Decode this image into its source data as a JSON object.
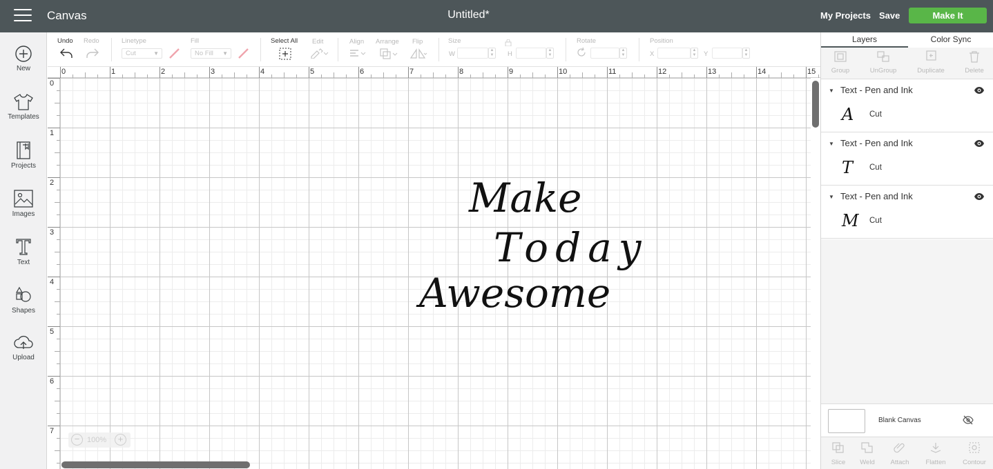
{
  "header": {
    "app_title": "Canvas",
    "doc_title": "Untitled*",
    "my_projects": "My Projects",
    "save": "Save",
    "make_it": "Make It",
    "make_it_color": "#59b648"
  },
  "sidebar": {
    "items": [
      {
        "label": "New",
        "icon": "plus-circle-icon"
      },
      {
        "label": "Templates",
        "icon": "tshirt-icon"
      },
      {
        "label": "Projects",
        "icon": "notebook-icon"
      },
      {
        "label": "Images",
        "icon": "image-icon"
      },
      {
        "label": "Text",
        "icon": "text-icon"
      },
      {
        "label": "Shapes",
        "icon": "shapes-icon"
      },
      {
        "label": "Upload",
        "icon": "upload-cloud-icon"
      }
    ]
  },
  "toolbar": {
    "undo": "Undo",
    "redo": "Redo",
    "linetype_label": "Linetype",
    "linetype_value": "Cut",
    "fill_label": "Fill",
    "fill_value": "No Fill",
    "select_all": "Select All",
    "edit": "Edit",
    "align": "Align",
    "arrange": "Arrange",
    "flip": "Flip",
    "size": "Size",
    "w": "W",
    "h": "H",
    "rotate": "Rotate",
    "position": "Position",
    "x": "X",
    "y": "Y"
  },
  "canvas": {
    "ruler_x": [
      "0",
      "1",
      "2",
      "3",
      "4",
      "5",
      "6",
      "7",
      "8",
      "9",
      "10",
      "11",
      "12",
      "13",
      "14",
      "15"
    ],
    "ruler_y": [
      "0",
      "1",
      "2",
      "3",
      "4",
      "5",
      "6",
      "7"
    ],
    "design_lines": [
      "Make",
      "Today",
      "Awesome"
    ],
    "zoom_value": "100%"
  },
  "panel": {
    "tabs": [
      "Layers",
      "Color Sync"
    ],
    "layer_tools": [
      "Group",
      "UnGroup",
      "Duplicate",
      "Delete"
    ],
    "layers": [
      {
        "name": "Text - Pen and Ink",
        "thumb": "A",
        "operation": "Cut"
      },
      {
        "name": "Text - Pen and Ink",
        "thumb": "T",
        "operation": "Cut"
      },
      {
        "name": "Text - Pen and Ink",
        "thumb": "M",
        "operation": "Cut"
      }
    ],
    "blank_canvas": "Blank Canvas",
    "bottom_tools": [
      "Slice",
      "Weld",
      "Attach",
      "Flatten",
      "Contour"
    ]
  }
}
